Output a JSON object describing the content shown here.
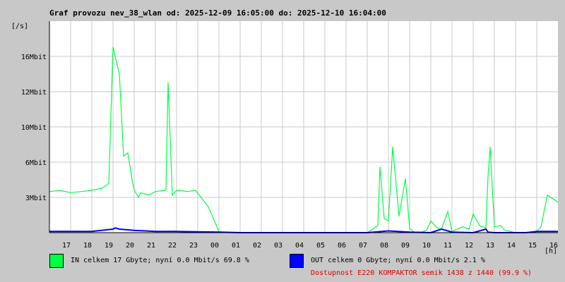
{
  "title": "Graf provozu nev_38_wlan od: 2025-12-09 16:05:00 do: 2025-12-10 16:04:00",
  "colors": {
    "in": "#00ff44",
    "out": "#0000ff",
    "availability": "#e00000",
    "background": "#c8c8c8",
    "plot": "#ffffff",
    "grid": "#c8c8c8"
  },
  "legend": {
    "in_label": "IN celkem 17 Gbyte; nyní   0.0 Mbit/s 69.8 %",
    "out_label": "OUT celkem 0 Gbyte; nyní   0.0 Mbit/s 2.1 %",
    "availability": "Dostupnost E220 KOMPAKTOR semik 1438 z 1440 (99.9 %)"
  },
  "chart_data": {
    "type": "area",
    "title": "Graf provozu nev_38_wlan od: 2025-12-09 16:05:00 do: 2025-12-10 16:04:00",
    "ylabel": "[/s]",
    "xlabel": "[h]",
    "x_tick_labels": [
      "17",
      "18",
      "19",
      "20",
      "21",
      "22",
      "23",
      "00",
      "01",
      "02",
      "03",
      "04",
      "05",
      "06",
      "07",
      "08",
      "09",
      "10",
      "11",
      "12",
      "13",
      "14",
      "15",
      "16"
    ],
    "y_tick_labels": [
      "3Mbit",
      "6Mbit",
      "10Mbit",
      "12Mbit",
      "16Mbit"
    ],
    "y_tick_values": [
      3,
      6,
      9,
      12,
      15
    ],
    "ylim": [
      0,
      18
    ],
    "xlim": [
      0,
      24
    ],
    "grid": true,
    "series": [
      {
        "name": "IN",
        "x": [
          0,
          0.5,
          1,
          1.5,
          2,
          2.5,
          2.8,
          3,
          3.3,
          3.5,
          3.7,
          3.9,
          4,
          4.1,
          4.2,
          4.3,
          4.5,
          4.7,
          5,
          5.5,
          5.6,
          5.8,
          6,
          6.2,
          6.5,
          6.9,
          7.5,
          8,
          8.3,
          8.5,
          8.6,
          8.8,
          9,
          9.5,
          10,
          11,
          12,
          13,
          14,
          15,
          15.5,
          15.6,
          15.8,
          16,
          16.2,
          16.5,
          16.8,
          17,
          17.2,
          17.5,
          17.8,
          18,
          18.3,
          18.5,
          18.8,
          19,
          19.5,
          19.8,
          20,
          20.3,
          20.6,
          20.7,
          20.8,
          21,
          21.3,
          21.5,
          22,
          22.5,
          22.7,
          22.8,
          23,
          23.2,
          23.5,
          24
        ],
        "values": [
          3.5,
          3.6,
          3.4,
          3.5,
          3.6,
          3.8,
          4.2,
          15.8,
          13.5,
          6.5,
          6.8,
          4.5,
          3.6,
          3.3,
          3.0,
          3.4,
          3.3,
          3.2,
          3.5,
          3.6,
          12.8,
          3.2,
          3.6,
          3.6,
          3.5,
          3.6,
          2.2,
          0.1,
          0,
          0,
          0,
          0,
          0,
          0,
          0,
          0,
          0,
          0,
          0,
          0,
          0.6,
          5.6,
          1.2,
          1.0,
          7.3,
          1.4,
          4.6,
          0.4,
          0,
          0,
          0.2,
          1.0,
          0.4,
          0.3,
          1.8,
          0.1,
          0.5,
          0.3,
          1.6,
          0.6,
          0.4,
          4.8,
          7.3,
          0.5,
          0.6,
          0.2,
          0,
          0,
          0,
          0,
          0.1,
          0.5,
          3.2,
          2.6
        ]
      },
      {
        "name": "OUT",
        "x": [
          0,
          1,
          2,
          3,
          3.1,
          3.3,
          4,
          5,
          6,
          8,
          9,
          15,
          16,
          17,
          18,
          18.5,
          19,
          20,
          20.6,
          20.7,
          21,
          22.5,
          23,
          24
        ],
        "values": [
          0.1,
          0.1,
          0.1,
          0.3,
          0.4,
          0.3,
          0.2,
          0.1,
          0.1,
          0.05,
          0,
          0,
          0.15,
          0.05,
          0,
          0.3,
          0.05,
          0,
          0.3,
          0.05,
          0,
          0,
          0.1,
          0.1
        ]
      }
    ]
  }
}
